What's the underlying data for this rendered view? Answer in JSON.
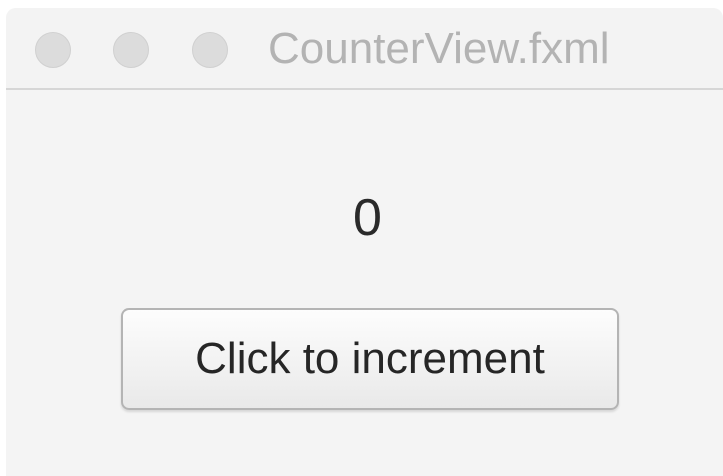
{
  "window": {
    "title": "CounterView.fxml"
  },
  "counter": {
    "value": "0"
  },
  "button": {
    "label": "Click to increment"
  },
  "colors": {
    "background": "#f4f4f4",
    "title_text": "#b3b3b3",
    "traffic_light": "#dcdcdc"
  },
  "icons": {
    "close": "close-traffic-light-icon",
    "minimize": "minimize-traffic-light-icon",
    "maximize": "maximize-traffic-light-icon"
  }
}
